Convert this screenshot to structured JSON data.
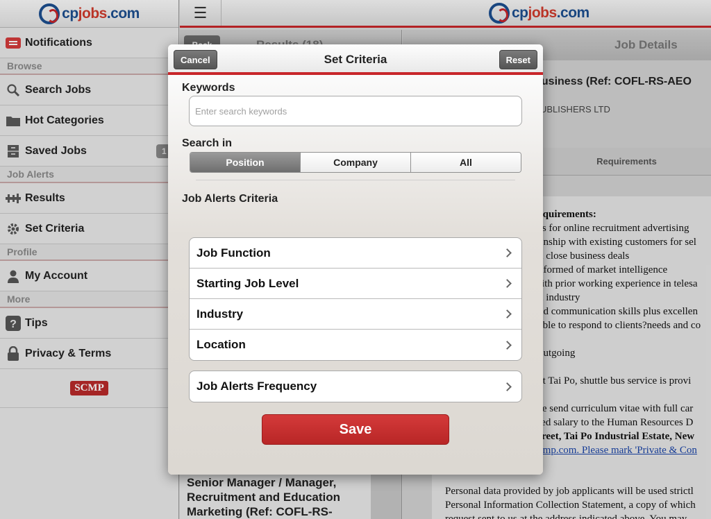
{
  "brand": {
    "cp": "cp",
    "jobs": "jobs",
    "com": ".com"
  },
  "sidebar": {
    "notifications": "Notifications",
    "section_browse": "Browse",
    "search_jobs": "Search Jobs",
    "hot_categories": "Hot Categories",
    "saved_jobs": "Saved Jobs",
    "saved_badge": "1",
    "section_job_alerts": "Job Alerts",
    "results": "Results",
    "set_criteria": "Set Criteria",
    "section_profile": "Profile",
    "my_account": "My Account",
    "section_more": "More",
    "tips": "Tips",
    "privacy_terms": "Privacy & Terms",
    "scmp": "SCMP"
  },
  "topbar": {
    "menu_icon": "☰"
  },
  "results_pane": {
    "back_label": "Back",
    "title": "Results (18)",
    "list_item": "Senior Manager / Manager, Recruitment and Education Marketing (Ref: COFL-RS-"
  },
  "details_pane": {
    "title": "Job Details",
    "job_title": "e Business (Ref: COFL-RS-AEO",
    "company": "T PUBLISHERS LTD",
    "requirements_tab": "Requirements",
    "lines": [
      "equirements:",
      "ss for online recruitment advertising",
      "onship with existing customers for sel",
      "d close business deals",
      "nformed of market intelligence",
      "rith prior working experience in telesa",
      "n industry",
      "nd communication skills plus excellen",
      "able to respond to clients?needs and co",
      "",
      "outgoing",
      "",
      "at Tai Po, shuttle bus service is provi",
      "",
      "se send curriculum vitae with full car",
      "ted salary to the Human Resources D",
      "treet, Tai Po Industrial Estate, New",
      "cmp.com. Please mark 'Private & Con"
    ],
    "bottom_lines": [
      "Personal data provided by job applicants will be used strictl",
      "Personal Information Collection Statement, a copy of which",
      "request sent to us at the address indicated above. You may"
    ]
  },
  "modal": {
    "title": "Set Criteria",
    "cancel": "Cancel",
    "reset": "Reset",
    "keywords_label": "Keywords",
    "keywords_value": "",
    "keywords_placeholder": "Enter search keywords",
    "search_in_label": "Search in",
    "search_in_options": [
      "Position",
      "Company",
      "All"
    ],
    "search_in_selected": "Position",
    "criteria_label": "Job Alerts Criteria",
    "criteria_items": [
      "Job Function",
      "Starting Job Level",
      "Industry",
      "Location"
    ],
    "frequency_item": "Job Alerts Frequency",
    "save": "Save"
  }
}
